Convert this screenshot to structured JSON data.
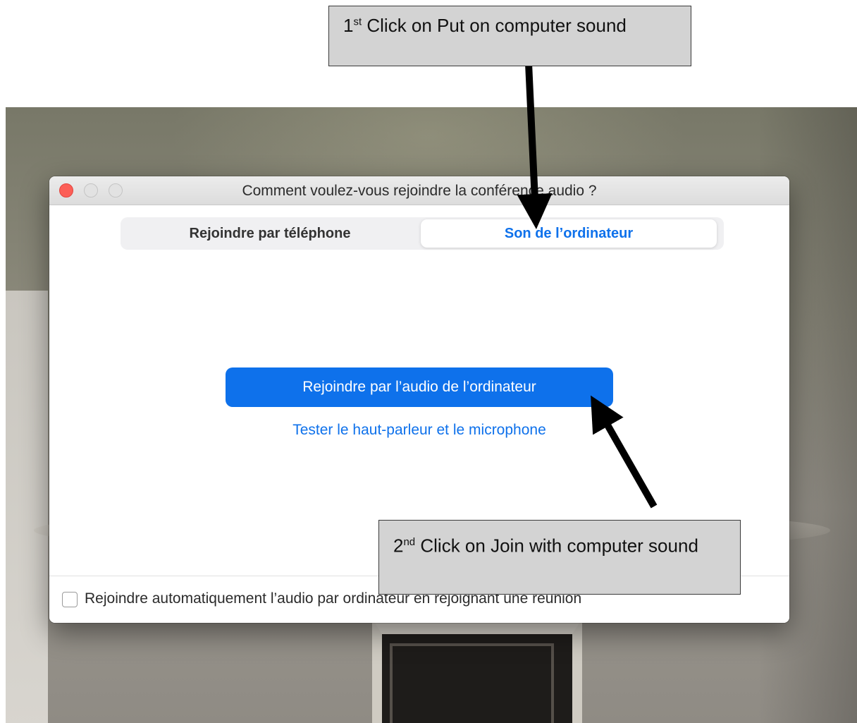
{
  "dialog": {
    "title": "Comment voulez-vous rejoindre la conférence audio ?",
    "tabs": [
      {
        "label": "Rejoindre par téléphone",
        "selected": false
      },
      {
        "label": "Son de l’ordinateur",
        "selected": true
      }
    ],
    "join_button_label": "Rejoindre par l’audio de l’ordinateur",
    "test_link_label": "Tester le haut-parleur et le microphone",
    "auto_join_checkbox_label": "Rejoindre automatiquement l’audio par ordinateur en rejoignant une réunion",
    "auto_join_checked": false
  },
  "annotations": {
    "step1": {
      "ordinal": "1",
      "suffix": "st",
      "text": " Click on Put on computer sound"
    },
    "step2": {
      "ordinal": "2",
      "suffix": "nd",
      "text": " Click on Join with computer sound"
    }
  },
  "colors": {
    "accent": "#0e71eb",
    "close_button": "#fc5f57",
    "callout_fill": "#d3d3d3"
  }
}
